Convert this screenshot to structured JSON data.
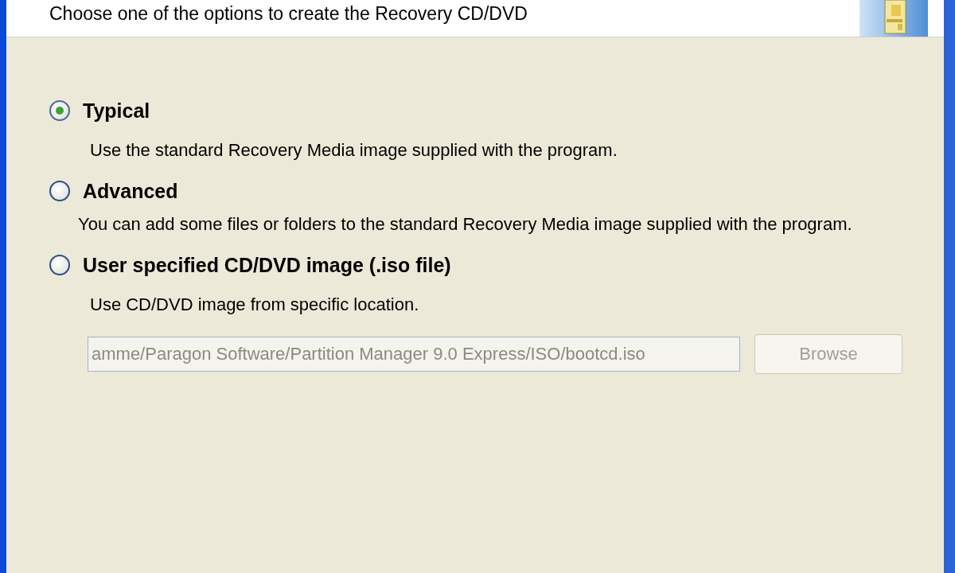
{
  "header": {
    "subtitle": "Choose one of the options to create the Recovery CD/DVD"
  },
  "options": [
    {
      "label": "Typical",
      "selected": true,
      "description": "Use the standard Recovery Media image supplied with the program."
    },
    {
      "label": "Advanced",
      "selected": false,
      "description": "You can add some files or folders to the standard Recovery Media image supplied with the program."
    },
    {
      "label": "User specified CD/DVD image (.iso file)",
      "selected": false,
      "description": "Use CD/DVD image from specific location."
    }
  ],
  "image_path": {
    "value": "amme/Paragon Software/Partition Manager 9.0 Express/ISO/bootcd.iso",
    "disabled": true
  },
  "browse_button": {
    "label": "Browse",
    "disabled": true
  }
}
